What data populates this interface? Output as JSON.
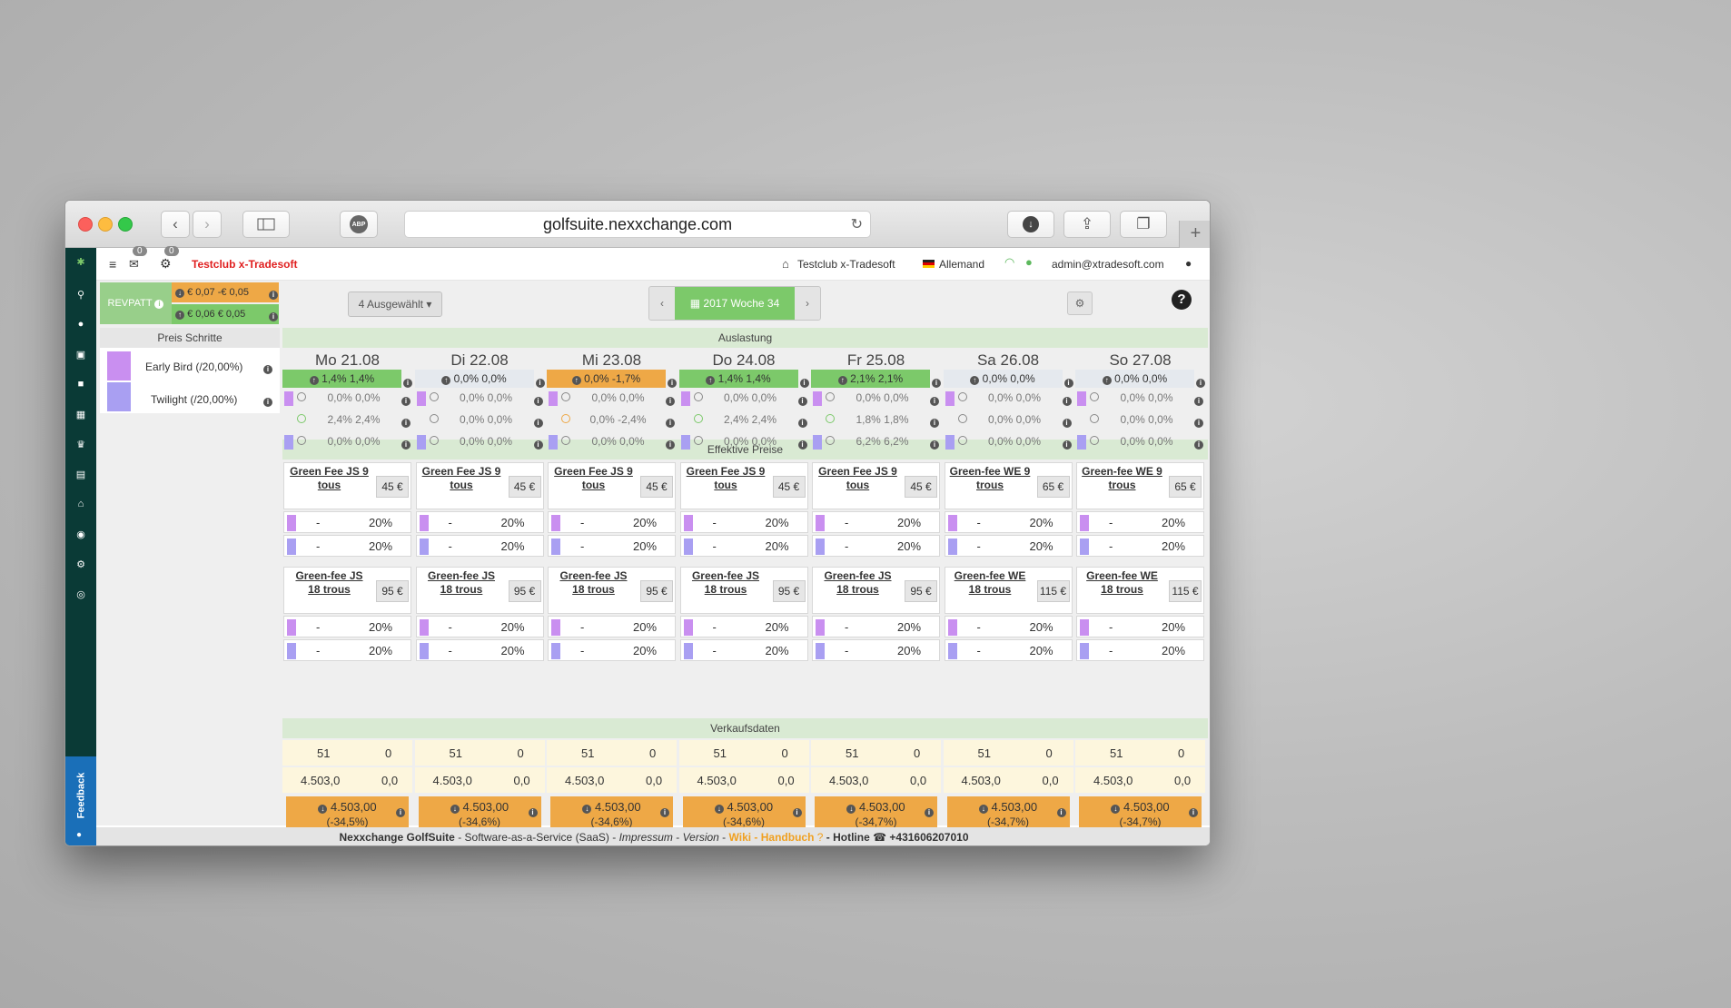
{
  "browser": {
    "url": "golfsuite.nexxchange.com",
    "abp": "ABP"
  },
  "nav": {
    "club_name": "Testclub x-Tradesoft",
    "mail_count": "0",
    "settings_count": "0",
    "club_link": "Testclub x-Tradesoft",
    "language": "Allemand",
    "user": "admin@xtradesoft.com"
  },
  "revpatt": {
    "label": "REVPATT",
    "row1": "€ 0,07 -€ 0,05",
    "row2": "€ 0,06 € 0,05"
  },
  "toolbar": {
    "selected": "4 Ausgewählt",
    "week": "2017 Woche 34"
  },
  "left_panel": {
    "title": "Preis Schritte",
    "items": [
      {
        "label": "Early Bird (/20,00%)",
        "color": "#c98ff0"
      },
      {
        "label": "Twilight (/20,00%)",
        "color": "#a99ff2"
      }
    ]
  },
  "sections": {
    "auslastung": "Auslastung",
    "effektive": "Effektive Preise",
    "verkauf": "Verkaufsdaten"
  },
  "days": [
    {
      "label": "Mo 21.08",
      "main": "1,4% 1,4%",
      "mc": "green",
      "r1": "0,0% 0,0%",
      "r2": "2,4% 2,4%",
      "r3": "0,0% 0,0%",
      "r2c": "#7cc96a",
      "p1n": "Green Fee JS 9",
      "p1s": "tous",
      "p1p": "45 €",
      "p2n": "Green-fee JS",
      "p2s": "18 trous",
      "p2p": "95 €",
      "s1": "51",
      "s2": "0",
      "s3": "4.503,0",
      "s4": "0,0",
      "t1": "4.503,00",
      "t2": "(-34,5%)"
    },
    {
      "label": "Di 22.08",
      "main": "0,0% 0,0%",
      "mc": "gray",
      "r1": "0,0% 0,0%",
      "r2": "0,0% 0,0%",
      "r3": "0,0% 0,0%",
      "r2c": "#888",
      "p1n": "Green Fee JS 9",
      "p1s": "tous",
      "p1p": "45 €",
      "p2n": "Green-fee JS",
      "p2s": "18 trous",
      "p2p": "95 €",
      "s1": "51",
      "s2": "0",
      "s3": "4.503,0",
      "s4": "0,0",
      "t1": "4.503,00",
      "t2": "(-34,6%)"
    },
    {
      "label": "Mi 23.08",
      "main": "0,0% -1,7%",
      "mc": "orange",
      "r1": "0,0% 0,0%",
      "r2": "0,0% -2,4%",
      "r3": "0,0% 0,0%",
      "r2c": "#eea846",
      "p1n": "Green Fee JS 9",
      "p1s": "tous",
      "p1p": "45 €",
      "p2n": "Green-fee JS",
      "p2s": "18 trous",
      "p2p": "95 €",
      "s1": "51",
      "s2": "0",
      "s3": "4.503,0",
      "s4": "0,0",
      "t1": "4.503,00",
      "t2": "(-34,6%)"
    },
    {
      "label": "Do 24.08",
      "main": "1,4% 1,4%",
      "mc": "green",
      "r1": "0,0% 0,0%",
      "r2": "2,4% 2,4%",
      "r3": "0,0% 0,0%",
      "r2c": "#7cc96a",
      "p1n": "Green Fee JS 9",
      "p1s": "tous",
      "p1p": "45 €",
      "p2n": "Green-fee JS",
      "p2s": "18 trous",
      "p2p": "95 €",
      "s1": "51",
      "s2": "0",
      "s3": "4.503,0",
      "s4": "0,0",
      "t1": "4.503,00",
      "t2": "(-34,6%)"
    },
    {
      "label": "Fr 25.08",
      "main": "2,1% 2,1%",
      "mc": "green",
      "r1": "0,0% 0,0%",
      "r2": "1,8% 1,8%",
      "r3": "6,2% 6,2%",
      "r2c": "#7cc96a",
      "p1n": "Green Fee JS 9",
      "p1s": "tous",
      "p1p": "45 €",
      "p2n": "Green-fee JS",
      "p2s": "18 trous",
      "p2p": "95 €",
      "s1": "51",
      "s2": "0",
      "s3": "4.503,0",
      "s4": "0,0",
      "t1": "4.503,00",
      "t2": "(-34,7%)"
    },
    {
      "label": "Sa 26.08",
      "main": "0,0% 0,0%",
      "mc": "gray",
      "r1": "0,0% 0,0%",
      "r2": "0,0% 0,0%",
      "r3": "0,0% 0,0%",
      "r2c": "#888",
      "p1n": "Green-fee WE 9",
      "p1s": "trous",
      "p1p": "65 €",
      "p2n": "Green-fee WE",
      "p2s": "18 trous",
      "p2p": "115 €",
      "s1": "51",
      "s2": "0",
      "s3": "4.503,0",
      "s4": "0,0",
      "t1": "4.503,00",
      "t2": "(-34,7%)"
    },
    {
      "label": "So 27.08",
      "main": "0,0% 0,0%",
      "mc": "gray",
      "r1": "0,0% 0,0%",
      "r2": "0,0% 0,0%",
      "r3": "0,0% 0,0%",
      "r2c": "#888",
      "p1n": "Green-fee WE 9",
      "p1s": "trous",
      "p1p": "65 €",
      "p2n": "Green-fee WE",
      "p2s": "18 trous",
      "p2p": "115 €",
      "s1": "51",
      "s2": "0",
      "s3": "4.503,0",
      "s4": "0,0",
      "t1": "4.503,00",
      "t2": "(-34,7%)"
    }
  ],
  "pricing": {
    "dash": "-",
    "pct": "20%"
  },
  "footer": {
    "brand": "Nexxchange GolfSuite",
    "saas": " - Software-as-a-Service (SaaS) - ",
    "impressum": "Impressum",
    "sep": " - ",
    "version": "Version",
    "wiki": "Wiki - Handbuch",
    "hotline": " - Hotline ",
    "phone": "+431606207010"
  },
  "feedback": "Feedback"
}
